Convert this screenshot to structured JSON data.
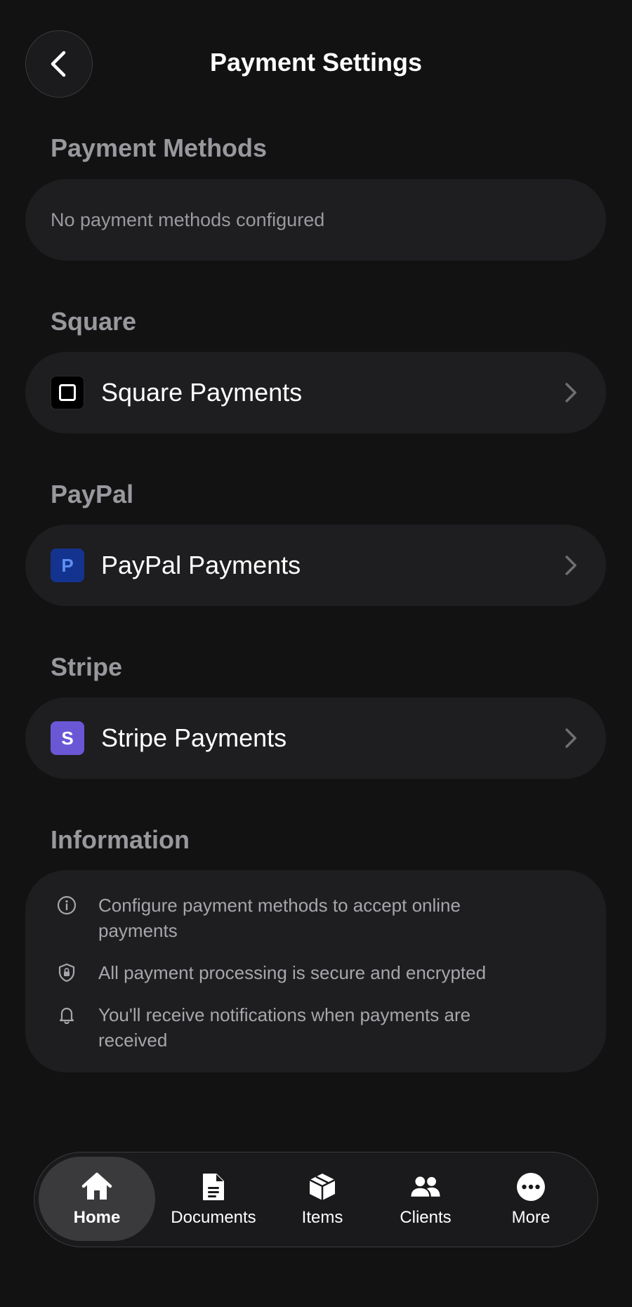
{
  "header": {
    "title": "Payment Settings",
    "back_icon": "chevron-left-icon"
  },
  "sections": {
    "payment_methods": {
      "title": "Payment Methods",
      "empty_text": "No payment methods configured"
    },
    "square": {
      "title": "Square",
      "row_label": "Square Payments",
      "icon": "square-logo-icon"
    },
    "paypal": {
      "title": "PayPal",
      "row_label": "PayPal Payments",
      "icon_letter": "P",
      "icon": "paypal-logo-icon"
    },
    "stripe": {
      "title": "Stripe",
      "row_label": "Stripe Payments",
      "icon_letter": "S",
      "icon": "stripe-logo-icon"
    },
    "information": {
      "title": "Information",
      "items": [
        {
          "icon": "info-circle-icon",
          "text": "Configure payment methods to accept online payments"
        },
        {
          "icon": "shield-lock-icon",
          "text": "All payment processing is secure and encrypted"
        },
        {
          "icon": "bell-icon",
          "text": "You'll receive notifications when payments are received"
        }
      ]
    }
  },
  "tabbar": {
    "tabs": [
      {
        "label": "Home",
        "icon": "house-icon",
        "active": true
      },
      {
        "label": "Documents",
        "icon": "document-icon",
        "active": false
      },
      {
        "label": "Items",
        "icon": "box-icon",
        "active": false
      },
      {
        "label": "Clients",
        "icon": "people-icon",
        "active": false
      },
      {
        "label": "More",
        "icon": "more-circle-icon",
        "active": false
      }
    ]
  },
  "colors": {
    "background": "#121213",
    "card": "#1e1e20",
    "section_title": "#98989d",
    "paypal_brand": "#14338f",
    "stripe_brand": "#6a57d6"
  }
}
